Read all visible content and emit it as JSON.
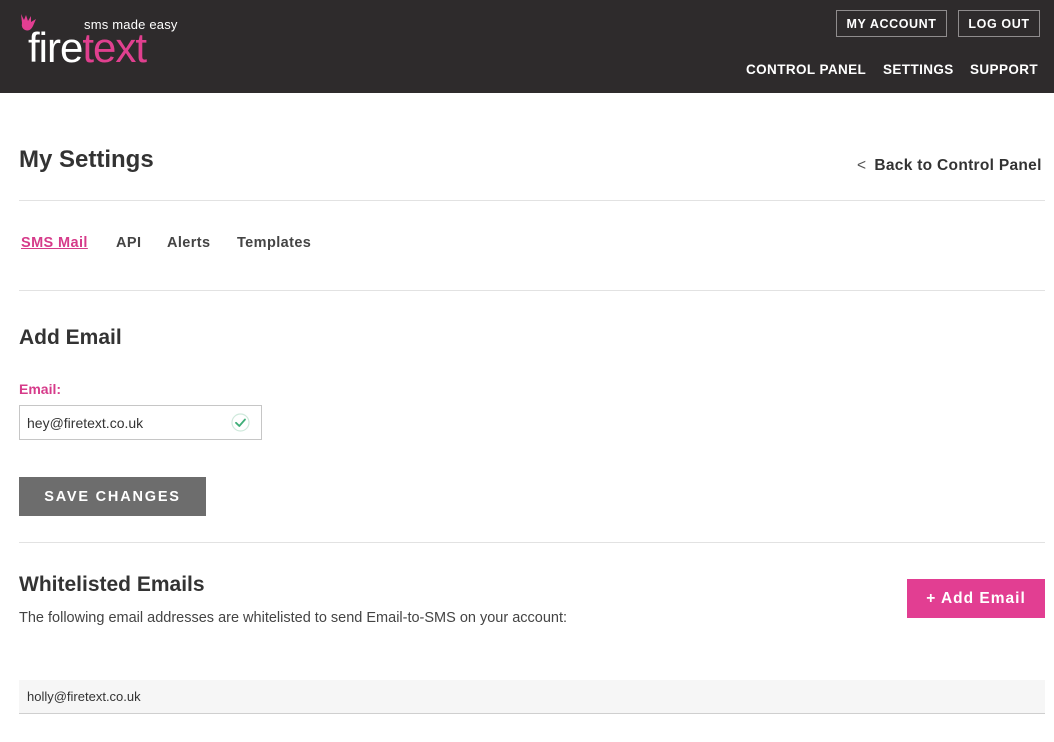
{
  "header": {
    "logo": {
      "tagline": "sms made easy",
      "word_part1": "fire",
      "word_part2": "text"
    },
    "top_buttons": {
      "my_account": "MY ACCOUNT",
      "log_out": "LOG OUT"
    },
    "nav": {
      "control_panel": "CONTROL PANEL",
      "settings": "SETTINGS",
      "support": "SUPPORT"
    }
  },
  "page": {
    "title": "My Settings",
    "back_link": {
      "icon": "chevron-left-icon",
      "chevron": "<",
      "label": "Back to Control Panel"
    }
  },
  "tabs": [
    {
      "label": "SMS Mail",
      "active": true
    },
    {
      "label": "API",
      "active": false
    },
    {
      "label": "Alerts",
      "active": false
    },
    {
      "label": "Templates",
      "active": false
    }
  ],
  "add_email": {
    "title": "Add Email",
    "label": "Email:",
    "value": "hey@firetext.co.uk",
    "valid_icon": "check-circle-icon",
    "save_label": "SAVE CHANGES"
  },
  "whitelist": {
    "title": "Whitelisted Emails",
    "description": "The following email addresses are whitelisted to send Email-to-SMS on your account:",
    "add_button": "+ Add Email",
    "emails": [
      "holly@firetext.co.uk"
    ]
  },
  "colors": {
    "header_bg": "#2e2b2c",
    "accent_pink": "#e23e92",
    "save_button_bg": "#6d6d6d"
  }
}
